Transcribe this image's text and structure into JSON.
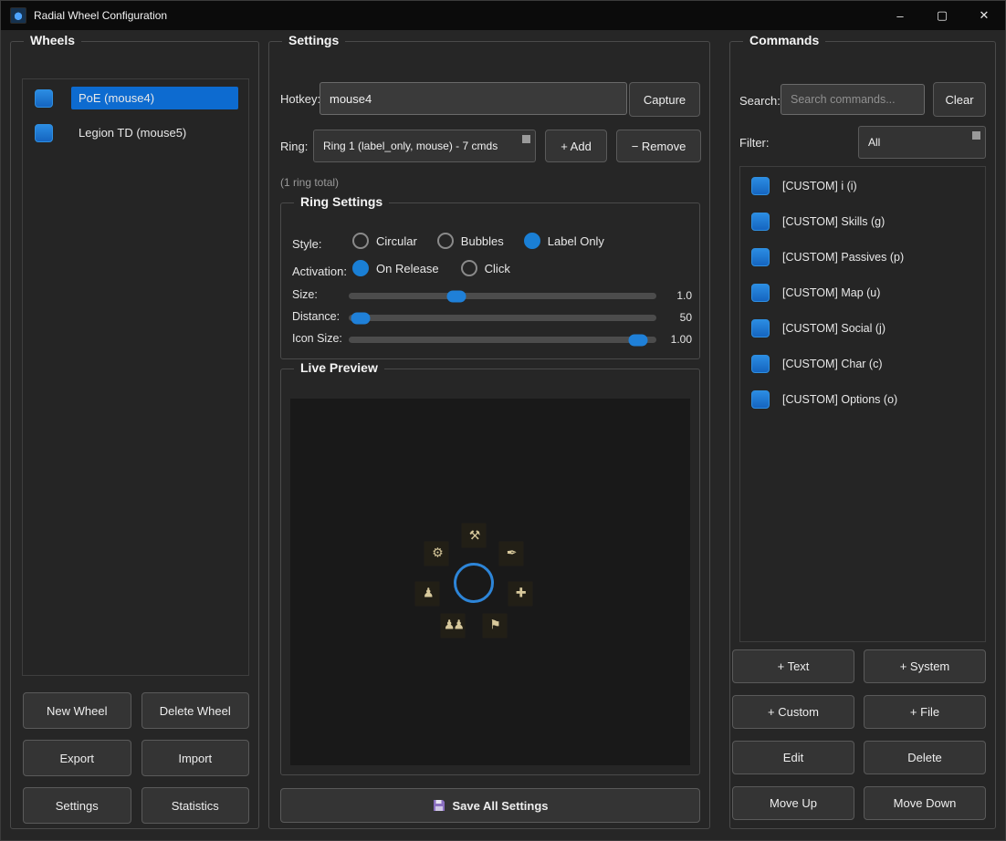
{
  "window": {
    "title": "Radial Wheel Configuration",
    "controls": {
      "minimize": "–",
      "maximize": "▢",
      "close": "✕"
    }
  },
  "wheels": {
    "group_label": "Wheels",
    "items": [
      {
        "label": "PoE (mouse4)",
        "selected": true
      },
      {
        "label": "Legion TD (mouse5)",
        "selected": false
      }
    ],
    "buttons": [
      "New Wheel",
      "Delete Wheel",
      "Export",
      "Import",
      "Settings",
      "Statistics"
    ]
  },
  "settings": {
    "group_label": "Settings",
    "hotkey_label": "Hotkey:",
    "hotkey_value": "mouse4",
    "capture_button": "Capture",
    "ring_label": "Ring:",
    "ring_value": "Ring 1 (label_only, mouse) - 7 cmds",
    "add_button": "+ Add",
    "remove_button": "− Remove",
    "ring_total": "(1 ring total)",
    "ring_settings": {
      "group_label": "Ring Settings",
      "style_label": "Style:",
      "style_options": [
        {
          "label": "Circular",
          "selected": false
        },
        {
          "label": "Bubbles",
          "selected": false
        },
        {
          "label": "Label Only",
          "selected": true
        }
      ],
      "activation_label": "Activation:",
      "activation_options": [
        {
          "label": "On Release",
          "selected": true
        },
        {
          "label": "Click",
          "selected": false
        }
      ],
      "sliders": [
        {
          "label": "Size:",
          "value": "1.0",
          "percent": 35
        },
        {
          "label": "Distance:",
          "value": "50",
          "percent": 4
        },
        {
          "label": "Icon Size:",
          "value": "1.00",
          "percent": 94
        }
      ]
    },
    "preview": {
      "group_label": "Live Preview",
      "icons": [
        {
          "name": "hammers-icon",
          "glyph": "⚒",
          "angle": -90
        },
        {
          "name": "quill-icon",
          "glyph": "✒",
          "angle": -38.6
        },
        {
          "name": "cross-icon",
          "glyph": "✚",
          "angle": 12.9
        },
        {
          "name": "flag-icon",
          "glyph": "⚑",
          "angle": 64.3
        },
        {
          "name": "people-icon",
          "glyph": "♟♟",
          "angle": 115.7
        },
        {
          "name": "person-icon",
          "glyph": "♟",
          "angle": 167.1
        },
        {
          "name": "gear-icon",
          "glyph": "⚙",
          "angle": 218.6
        }
      ]
    },
    "save_button": "Save All Settings"
  },
  "commands": {
    "group_label": "Commands",
    "search_label": "Search:",
    "search_placeholder": "Search commands...",
    "clear_button": "Clear",
    "filter_label": "Filter:",
    "filter_value": "All",
    "items": [
      "[CUSTOM] i (i)",
      "[CUSTOM] Skills (g)",
      "[CUSTOM] Passives (p)",
      "[CUSTOM] Map (u)",
      "[CUSTOM] Social (j)",
      "[CUSTOM] Char (c)",
      "[CUSTOM] Options (o)"
    ],
    "buttons": [
      "+ Text",
      "+ System",
      "+ Custom",
      "+ File",
      "Edit",
      "Delete",
      "Move Up",
      "Move Down"
    ]
  },
  "colors": {
    "accent": "#1a7fd5",
    "selection": "#0d6bd0",
    "preview_icon": "#d8c99c",
    "background": "#262626",
    "titlebar": "#0b0b0b"
  }
}
